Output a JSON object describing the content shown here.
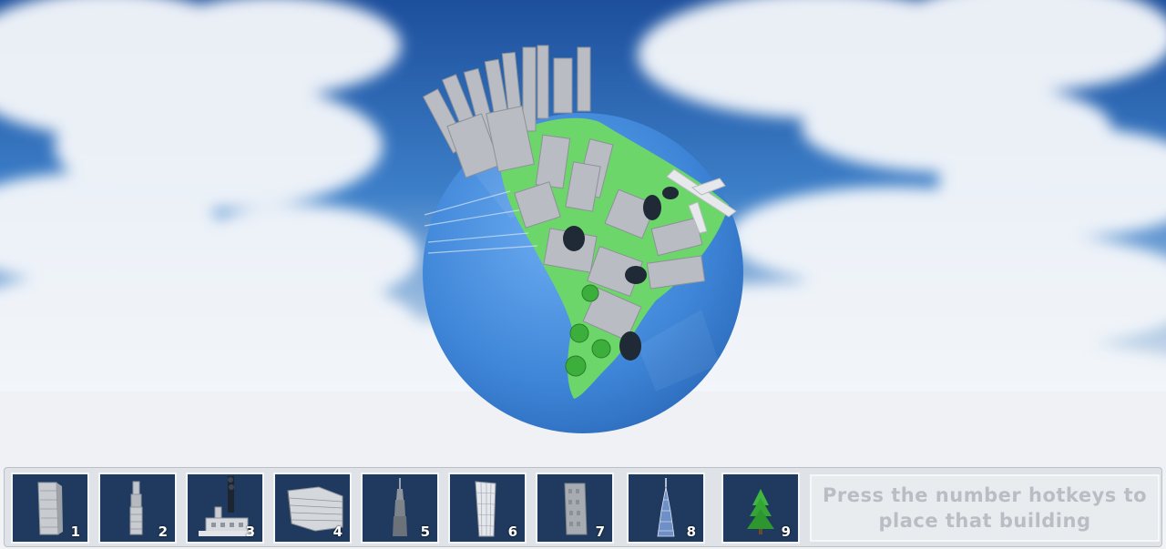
{
  "hotbar": {
    "slots": [
      {
        "key": "1",
        "icon": "tall-glass-tower-icon"
      },
      {
        "key": "2",
        "icon": "slim-tower-icon"
      },
      {
        "key": "3",
        "icon": "factory-icon"
      },
      {
        "key": "4",
        "icon": "curved-office-building-icon"
      },
      {
        "key": "5",
        "icon": "spire-skyscraper-icon"
      },
      {
        "key": "6",
        "icon": "glass-skyscraper-icon"
      },
      {
        "key": "7",
        "icon": "stone-tower-icon"
      },
      {
        "key": "8",
        "icon": "needle-tower-icon"
      },
      {
        "key": "9",
        "icon": "pine-tree-icon"
      }
    ],
    "hint": "Press the number hotkeys to place that building"
  },
  "colors": {
    "sky_top": "#1d4f9c",
    "sky_mid": "#3d7fc8",
    "horizon": "#eef1f4",
    "ocean": "#4a8fdc",
    "land": "#6cd66a",
    "slot_background": "#1f3a5e",
    "hint_text": "#b9bec5"
  }
}
